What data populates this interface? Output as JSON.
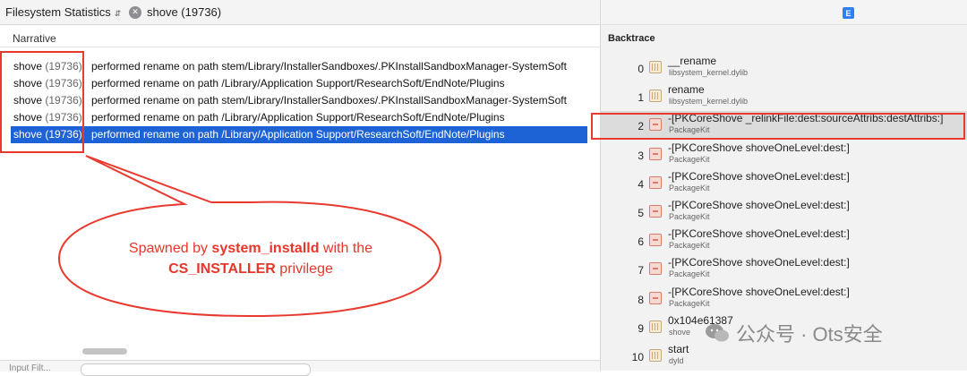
{
  "toolbar": {
    "view_selector": "Filesystem Statistics",
    "process_chip": "shove (19736)",
    "e_badge": "E"
  },
  "narrative": {
    "header": "Narrative",
    "rows": [
      {
        "proc": "shove",
        "pid": "(19736)",
        "text": "performed rename on path stem/Library/InstallerSandboxes/.PKInstallSandboxManager-SystemSoft"
      },
      {
        "proc": "shove",
        "pid": "(19736)",
        "text": "performed rename on path /Library/Application Support/ResearchSoft/EndNote/Plugins"
      },
      {
        "proc": "shove",
        "pid": "(19736)",
        "text": "performed rename on path stem/Library/InstallerSandboxes/.PKInstallSandboxManager-SystemSoft"
      },
      {
        "proc": "shove",
        "pid": "(19736)",
        "text": "performed rename on path /Library/Application Support/ResearchSoft/EndNote/Plugins"
      },
      {
        "proc": "shove",
        "pid": "(19736)",
        "text": "performed rename on path /Library/Application Support/ResearchSoft/EndNote/Plugins"
      }
    ],
    "selected_row_index": 4
  },
  "bottom": {
    "label": "Input Filt..."
  },
  "annotation": {
    "prefix": "Spawned by ",
    "bold1": "system_installd",
    "middle": " with the",
    "bold2": "CS_INSTALLER",
    "suffix": " privilege",
    "color": "#e8362a"
  },
  "backtrace": {
    "title": "Backtrace",
    "frames": [
      {
        "num": "0",
        "fn": "__rename",
        "lib": "libsystem_kernel.dylib",
        "icon": "library-icon"
      },
      {
        "num": "1",
        "fn": "rename",
        "lib": "libsystem_kernel.dylib",
        "icon": "library-icon"
      },
      {
        "num": "2",
        "fn": "-[PKCoreShove _relinkFile:dest:sourceAttribs:destAttribs:]",
        "lib": "PackageKit",
        "icon": "package-icon"
      },
      {
        "num": "3",
        "fn": "-[PKCoreShove shoveOneLevel:dest:]",
        "lib": "PackageKit",
        "icon": "package-icon"
      },
      {
        "num": "4",
        "fn": "-[PKCoreShove shoveOneLevel:dest:]",
        "lib": "PackageKit",
        "icon": "package-icon"
      },
      {
        "num": "5",
        "fn": "-[PKCoreShove shoveOneLevel:dest:]",
        "lib": "PackageKit",
        "icon": "package-icon"
      },
      {
        "num": "6",
        "fn": "-[PKCoreShove shoveOneLevel:dest:]",
        "lib": "PackageKit",
        "icon": "package-icon"
      },
      {
        "num": "7",
        "fn": "-[PKCoreShove shoveOneLevel:dest:]",
        "lib": "PackageKit",
        "icon": "package-icon"
      },
      {
        "num": "8",
        "fn": "-[PKCoreShove shoveOneLevel:dest:]",
        "lib": "PackageKit",
        "icon": "package-icon"
      },
      {
        "num": "9",
        "fn": "0x104e61387",
        "lib": "shove",
        "icon": "library-icon"
      },
      {
        "num": "10",
        "fn": "start",
        "lib": "dyld",
        "icon": "library-icon"
      }
    ],
    "selected_frame_index": 2
  },
  "watermark": "公众号 · Ots安全"
}
